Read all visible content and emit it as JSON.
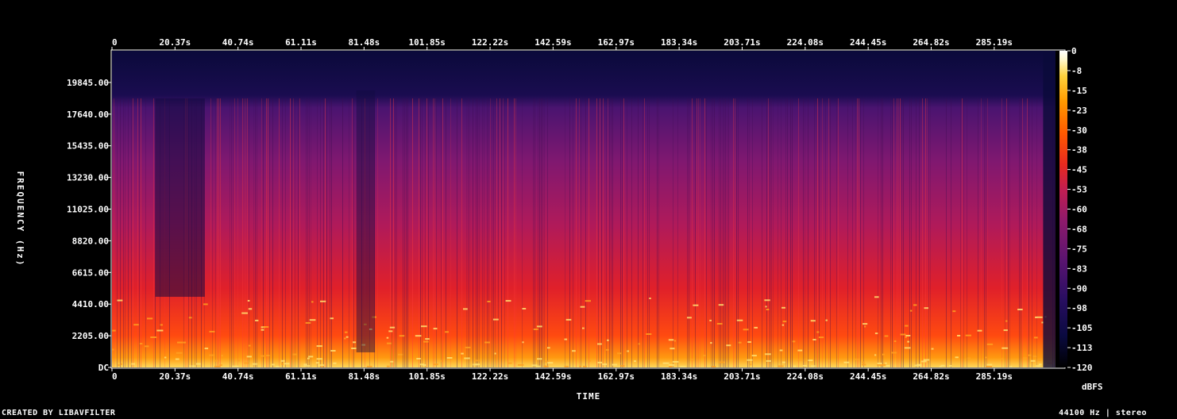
{
  "chart_data": {
    "type": "heatmap",
    "xlabel": "TIME",
    "ylabel": "FREQUENCY (Hz)",
    "colorbar_label": "dBFS",
    "x_ticks": [
      "0",
      "20.37s",
      "40.74s",
      "61.11s",
      "81.48s",
      "101.85s",
      "122.22s",
      "142.59s",
      "162.97s",
      "183.34s",
      "203.71s",
      "224.08s",
      "244.45s",
      "264.82s",
      "285.19s"
    ],
    "x_tick_values": [
      0,
      20.37,
      40.74,
      61.11,
      81.48,
      101.85,
      122.22,
      142.59,
      162.97,
      183.34,
      203.71,
      224.08,
      244.45,
      264.82,
      285.19
    ],
    "xlim": [
      0,
      305
    ],
    "y_ticks": [
      "DC",
      "2205.00",
      "4410.00",
      "6615.00",
      "8820.00",
      "11025.00",
      "13230.00",
      "15435.00",
      "17640.00",
      "19845.00"
    ],
    "y_tick_values": [
      0,
      2205,
      4410,
      6615,
      8820,
      11025,
      13230,
      15435,
      17640,
      19845
    ],
    "ylim": [
      0,
      22050
    ],
    "colorbar_ticks": [
      "0",
      "-8",
      "-15",
      "-23",
      "-30",
      "-38",
      "-45",
      "-53",
      "-60",
      "-68",
      "-75",
      "-83",
      "-90",
      "-98",
      "-105",
      "-113",
      "-120"
    ],
    "colorbar_range": [
      -120,
      0
    ],
    "colormap": [
      "#000000",
      "#0a0a40",
      "#2a0e62",
      "#5a1470",
      "#8c1a6c",
      "#c01e52",
      "#e82a20",
      "#ff5a00",
      "#ff9a00",
      "#ffd23c",
      "#fff7c8",
      "#ffffff"
    ]
  },
  "footer": {
    "left": "CREATED BY LIBAVFILTER",
    "right": "44100 Hz | stereo"
  }
}
